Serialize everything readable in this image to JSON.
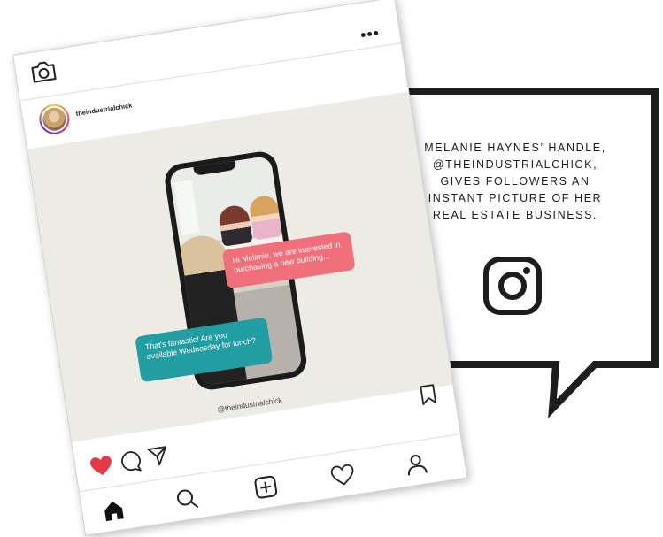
{
  "post": {
    "username": "theindustrialchick",
    "messages": {
      "incoming": "Hi Melanie, we are interested in purchasing a new building...",
      "outgoing": "That's fantastic! Are you available Wednesday for lunch?"
    },
    "image_handle": "@theindustrialchick",
    "liked": true
  },
  "callout": {
    "lines": [
      "MELANIE HAYNES’ HANDLE,",
      "@THEINDUSTRIALCHICK,",
      "GIVES FOLLOWERS AN",
      "INSTANT PICTURE OF HER",
      "REAL ESTATE BUSINESS."
    ]
  },
  "icons": {
    "top": [
      "camera-icon",
      "send-icon",
      "more-icon"
    ],
    "actions": [
      "heart-icon",
      "comment-icon",
      "share-icon",
      "bookmark-icon"
    ],
    "nav": [
      "home-icon",
      "search-icon",
      "add-post-icon",
      "activity-heart-icon",
      "profile-icon"
    ],
    "brand": "instagram-icon"
  },
  "colors": {
    "like_red": "#e63946",
    "chat_pink": "#ef6f7b",
    "chat_teal": "#229ea2",
    "outline": "#1d1d1d"
  }
}
